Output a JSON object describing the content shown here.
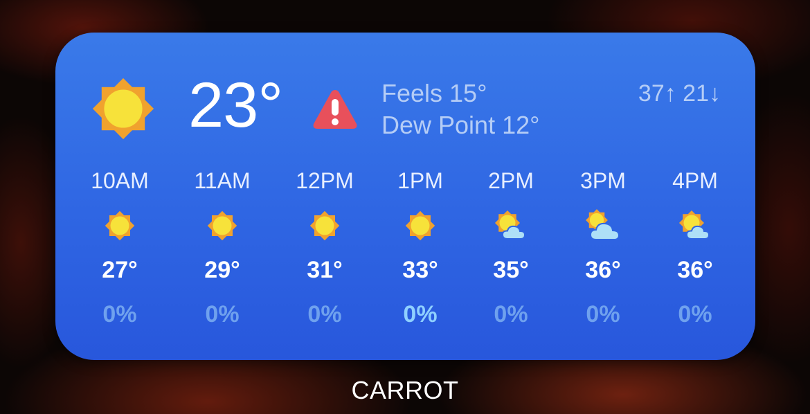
{
  "wallpaper": {
    "description_color": "#0c0605"
  },
  "widget": {
    "accent": "#3a7ae9",
    "current": {
      "icon": "sun-icon",
      "temperature": "23°",
      "alert_icon": "warning-icon",
      "feels": "Feels 15°",
      "dew_point": "Dew Point 12°",
      "high_low": "37↑ 21↓"
    },
    "hours": [
      {
        "time": "10AM",
        "icon": "sun-icon",
        "temp": "27°",
        "precip": "0%"
      },
      {
        "time": "11AM",
        "icon": "sun-icon",
        "temp": "29°",
        "precip": "0%"
      },
      {
        "time": "12PM",
        "icon": "sun-icon",
        "temp": "31°",
        "precip": "0%"
      },
      {
        "time": "1PM",
        "icon": "sun-icon",
        "temp": "33°",
        "precip": "0%"
      },
      {
        "time": "2PM",
        "icon": "partly-cloudy-icon",
        "temp": "35°",
        "precip": "0%"
      },
      {
        "time": "3PM",
        "icon": "mostly-cloudy-icon",
        "temp": "36°",
        "precip": "0%"
      },
      {
        "time": "4PM",
        "icon": "partly-cloudy-icon",
        "temp": "36°",
        "precip": "0%"
      }
    ]
  },
  "app_label": "CARROT"
}
